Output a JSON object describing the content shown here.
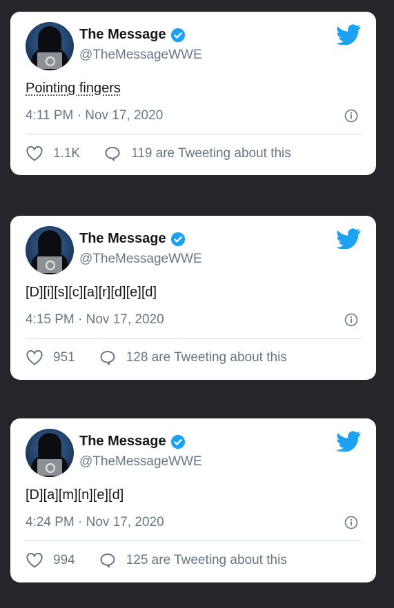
{
  "tweets": [
    {
      "name": "The Message",
      "handle": "@TheMessageWWE",
      "text": "Pointing fingers",
      "timestamp": "4:11 PM · Nov 17, 2020",
      "likes": "1.1K",
      "tweeting": "119 are Tweeting about this"
    },
    {
      "name": "The Message",
      "handle": "@TheMessageWWE",
      "text": "[D][i][s][c][a][r][d][e][d]",
      "timestamp": "4:15 PM · Nov 17, 2020",
      "likes": "951",
      "tweeting": "128 are Tweeting about this"
    },
    {
      "name": "The Message",
      "handle": "@TheMessageWWE",
      "text": "[D][a][m][n][e][d]",
      "timestamp": "4:24 PM · Nov 17, 2020",
      "likes": "994",
      "tweeting": "125 are Tweeting about this"
    }
  ],
  "colors": {
    "twitter_blue": "#1da1f2",
    "muted": "#657786",
    "background": "#24262b"
  }
}
